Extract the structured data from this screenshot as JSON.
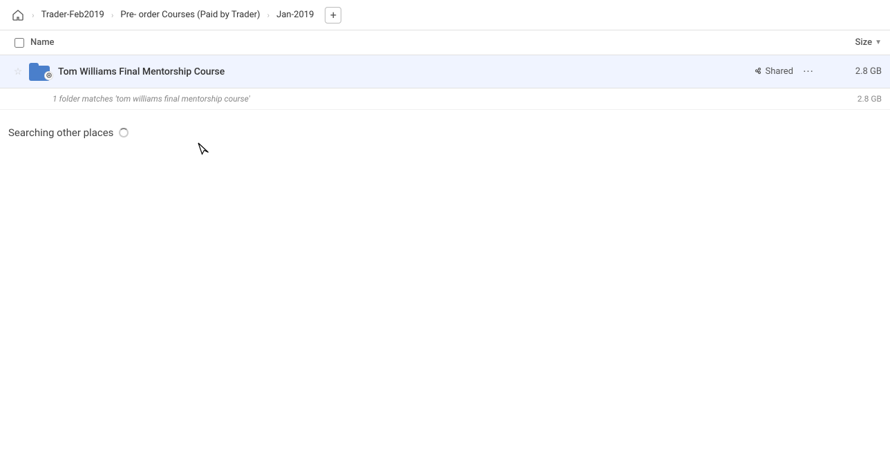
{
  "breadcrumb": {
    "home_icon": "🏠",
    "items": [
      {
        "label": "Trader-Feb2019"
      },
      {
        "label": "Pre- order Courses (Paid by Trader)"
      },
      {
        "label": "Jan-2019"
      }
    ],
    "add_icon": "+"
  },
  "columns": {
    "name_label": "Name",
    "size_label": "Size"
  },
  "file_row": {
    "folder_name": "Tom Williams Final Mentorship Course",
    "shared_label": "Shared",
    "size": "2.8 GB",
    "more_dots": "···"
  },
  "match_info": {
    "text": "1 folder matches 'tom williams final mentorship course'",
    "size": "2.8 GB"
  },
  "searching": {
    "label": "Searching other places"
  }
}
